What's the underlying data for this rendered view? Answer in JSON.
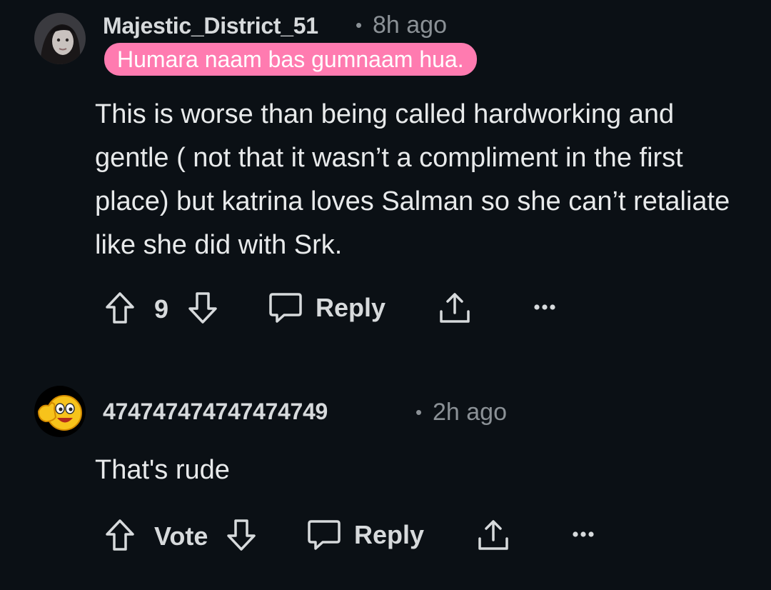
{
  "comments": [
    {
      "username": "Majestic_District_51",
      "separator": "•",
      "time": "8h ago",
      "flair": "Humara naam bas gumnaam hua.",
      "body": "This is worse than being called hardworking and gentle ( not that it wasn’t a compliment in the first place) but katrina loves Salman so she can’t retaliate like she did with Srk.",
      "score": "9",
      "reply_label": "Reply",
      "avatar_icon": "user-portrait-avatar"
    },
    {
      "username": "474747474747474749",
      "separator": "•",
      "time": "2h ago",
      "body": "That's rude",
      "score": "Vote",
      "reply_label": "Reply",
      "avatar_icon": "thumbs-up-smiley-avatar"
    }
  ],
  "colors": {
    "background": "#0b1015",
    "flair_bg": "#ff7bb0",
    "text": "#d7dadc",
    "muted": "#8b9196"
  }
}
